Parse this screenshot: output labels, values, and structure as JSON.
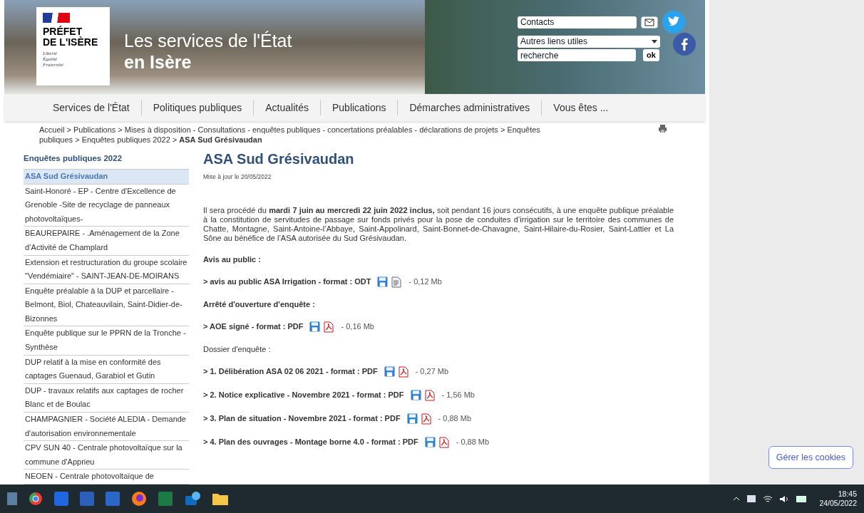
{
  "header": {
    "logo": {
      "lines": [
        "PRÉFET",
        "DE L'ISÈRE"
      ],
      "motto": [
        "Liberté",
        "Égalité",
        "Fraternité"
      ]
    },
    "title": "Les services de l'État",
    "subtitle": "en Isère",
    "contacts": "Contacts",
    "links_select": "Autres liens utiles",
    "search": {
      "placeholder": "recherche"
    },
    "search_button": "ok"
  },
  "nav": [
    "Services de l'État",
    "Politiques publiques",
    "Actualités",
    "Publications",
    "Démarches administratives",
    "Vous êtes ..."
  ],
  "breadcrumb": "Accueil > Publications > Mises à disposition - Consultations - enquêtes publiques - concertations préalables - déclarations de projets > Enquêtes publiques > Enquêtes publiques 2022 > **ASA Sud Grésivaudan**",
  "sidebar": {
    "heading": "Enquêtes publiques 2022",
    "items": [
      {
        "label": "ASA Sud Grésivaudan",
        "selected": true
      },
      {
        "label": "Saint-Honoré - EP - Centre d'Excellence de Grenoble -Site de recyclage de panneaux photovoltaïques-",
        "selected": false
      },
      {
        "label": "BEAUREPAIRE - .Aménagement de la Zone d’Activité de Champlard",
        "selected": false
      },
      {
        "label": "Extension et restructuration du groupe scolaire \"Vendémiaire\" - SAINT-JEAN-DE-MOIRANS",
        "selected": false
      },
      {
        "label": "Enquête préalable à la DUP et parcellaire - Belmont, Biol, Chateauvilain, Saint-Didier-de-Bizonnes",
        "selected": false
      },
      {
        "label": "Enquête publique sur le PPRN de la Tronche - Synthèse",
        "selected": false
      },
      {
        "label": "DUP relatif à la mise en conformité des captages Guenaud, Garabiol et Gutin",
        "selected": false
      },
      {
        "label": "DUP - travaux relatifs aux captages de rocher Blanc et de Boulac",
        "selected": false
      },
      {
        "label": "CHAMPAGNIER - Société ALEDIA - Demande d'autorisation environnementale",
        "selected": false
      },
      {
        "label": "CPV SUN 40 - Centrale photovoltaïque sur la commune d'Apprieu",
        "selected": false
      },
      {
        "label": "NEOEN - Centrale photovoltaïque de",
        "selected": false
      }
    ]
  },
  "article": {
    "title": "ASA Sud Grésivaudan",
    "updated": "Mise à jour le 20/05/2022",
    "intro": "Il sera procédé du **mardi 7 juin au mercredi 22 juin 2022 inclus,** soit pendant 16 jours consécutifs, à une enquête publique préalable à la constitution de servitudes de passage sur fonds privés pour la pose de conduites d’irrigation sur le territoire des communes de Chatte, Montagne, Saint-Antoine-l’Abbaye, Saint-Appolinard, Saint-Bonnet-de-Chavagne, Saint-Hilaire-du-Rosier, Saint-Lattier et La Sône au bénéfice de l’ASA autorisée du Sud Grésivaudan.",
    "blocks": [
      {
        "kind": "heading",
        "text": "Avis au public :"
      },
      {
        "kind": "document",
        "text": "> avis au public ASA Irrigation - format : ODT",
        "file": {
          "kind": "odt"
        },
        "size": "- 0,12 Mb"
      },
      {
        "kind": "heading",
        "text": "Arrêté d'ouverture d'enquête :"
      },
      {
        "kind": "document",
        "text": "> AOE signé - format : PDF",
        "file": {
          "kind": "pdf"
        },
        "size": "- 0,16 Mb"
      },
      {
        "kind": "text",
        "text": "Dossier d'enquête :"
      },
      {
        "kind": "document",
        "text": "> 1. Délibération ASA 02 06 2021 - format : PDF",
        "file": {
          "kind": "pdf"
        },
        "size": "- 0,27 Mb"
      },
      {
        "kind": "document",
        "text": "> 2. Notice explicative - Novembre 2021 - format : PDF",
        "file": {
          "kind": "pdf"
        },
        "size": "- 1,56 Mb"
      },
      {
        "kind": "document",
        "text": "> 3. Plan de situation - Novembre 2021 - format : PDF",
        "file": {
          "kind": "pdf"
        },
        "size": "- 0,88 Mb"
      },
      {
        "kind": "document",
        "text": "> 4. Plan des ouvrages - Montage borne 4.0 - format : PDF",
        "file": {
          "kind": "pdf"
        },
        "size": "- 0,88 Mb"
      }
    ]
  },
  "cookie_button": "Gérer les cookies",
  "taskbar": {
    "time": "18:45",
    "date": "24/05/2022"
  }
}
